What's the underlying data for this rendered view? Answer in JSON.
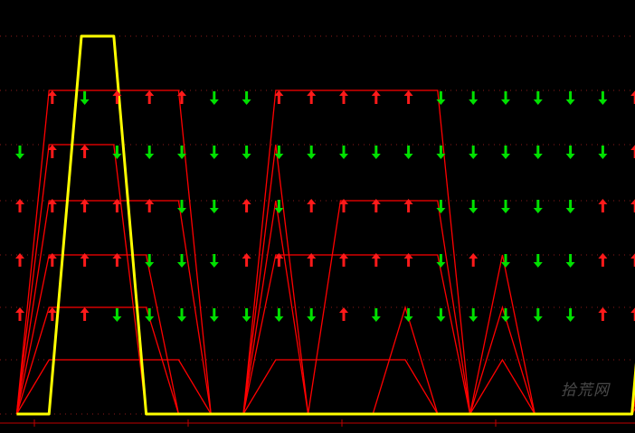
{
  "colors": {
    "background": "#000000",
    "primary_line": "#ffff00",
    "secondary_lines": "#ff0000",
    "up_arrow": "#ff1a1a",
    "down_arrow": "#00e000",
    "grid": "#8b1a1a",
    "axis": "#c00000"
  },
  "watermark": {
    "text": "拾荒网"
  },
  "chart_data": {
    "type": "line",
    "title": "",
    "xlabel": "",
    "ylabel": "",
    "grid": true,
    "levels": [
      0,
      1,
      2,
      3,
      4,
      5,
      6
    ],
    "ylim": [
      0,
      7
    ],
    "x": [
      0,
      1,
      2,
      3,
      4,
      5,
      6,
      7,
      8,
      9,
      10,
      11,
      12,
      13,
      14,
      15,
      16,
      17,
      18,
      19
    ],
    "signals": [
      [
        "none",
        "up",
        "down",
        "up",
        "up",
        "up",
        "down",
        "down",
        "up",
        "up",
        "up",
        "up",
        "up",
        "down",
        "down",
        "down",
        "down",
        "down",
        "down",
        "up"
      ],
      [
        "down",
        "up",
        "up",
        "down",
        "down",
        "down",
        "down",
        "down",
        "down",
        "down",
        "down",
        "down",
        "down",
        "down",
        "down",
        "down",
        "down",
        "down",
        "down",
        "up"
      ],
      [
        "up",
        "up",
        "up",
        "up",
        "up",
        "down",
        "down",
        "up",
        "down",
        "up",
        "up",
        "up",
        "up",
        "down",
        "down",
        "down",
        "down",
        "down",
        "up",
        "up"
      ],
      [
        "up",
        "up",
        "up",
        "up",
        "down",
        "down",
        "down",
        "up",
        "up",
        "up",
        "up",
        "up",
        "up",
        "down",
        "up",
        "down",
        "down",
        "down",
        "up",
        "up"
      ],
      [
        "up",
        "up",
        "up",
        "down",
        "down",
        "down",
        "down",
        "down",
        "down",
        "down",
        "up",
        "down",
        "down",
        "down",
        "down",
        "down",
        "down",
        "down",
        "up",
        "up"
      ]
    ],
    "series": [
      {
        "values": [
          0,
          0,
          6,
          6,
          0,
          0,
          0,
          0,
          0,
          0,
          0,
          0,
          0,
          0,
          0,
          0,
          0,
          0,
          0,
          0,
          6,
          0
        ]
      },
      {
        "values": [
          0,
          5,
          5,
          5,
          5,
          5,
          0,
          0,
          5,
          5,
          5,
          5,
          5,
          5,
          0,
          0,
          0,
          0,
          0,
          0,
          5,
          5
        ]
      },
      {
        "values": [
          0,
          4,
          4,
          4,
          0,
          0,
          0,
          0,
          4,
          0,
          0,
          0,
          0,
          0,
          0,
          0,
          0,
          0,
          0,
          0,
          4,
          0
        ]
      },
      {
        "values": [
          0,
          3,
          3,
          3,
          3,
          3,
          0,
          0,
          3,
          0,
          3,
          3,
          3,
          3,
          0,
          0,
          0,
          0,
          0,
          0,
          3,
          3
        ]
      },
      {
        "values": [
          0,
          2,
          2,
          2,
          2,
          0,
          0,
          0,
          2,
          2,
          2,
          2,
          2,
          2,
          0,
          2,
          0,
          0,
          0,
          0,
          2,
          2
        ]
      },
      {
        "values": [
          0,
          1,
          1,
          1,
          1,
          0,
          0,
          0,
          0,
          0,
          0,
          0,
          1,
          0,
          0,
          1,
          0,
          0,
          0,
          0,
          1,
          1
        ]
      },
      {
        "values": [
          0,
          0.5,
          0.5,
          0.5,
          0.5,
          0.5,
          0,
          0,
          0.5,
          0.5,
          0.5,
          0.5,
          0.5,
          0,
          0,
          0.5,
          0,
          0,
          0,
          0,
          0.5,
          0.5
        ]
      }
    ]
  }
}
